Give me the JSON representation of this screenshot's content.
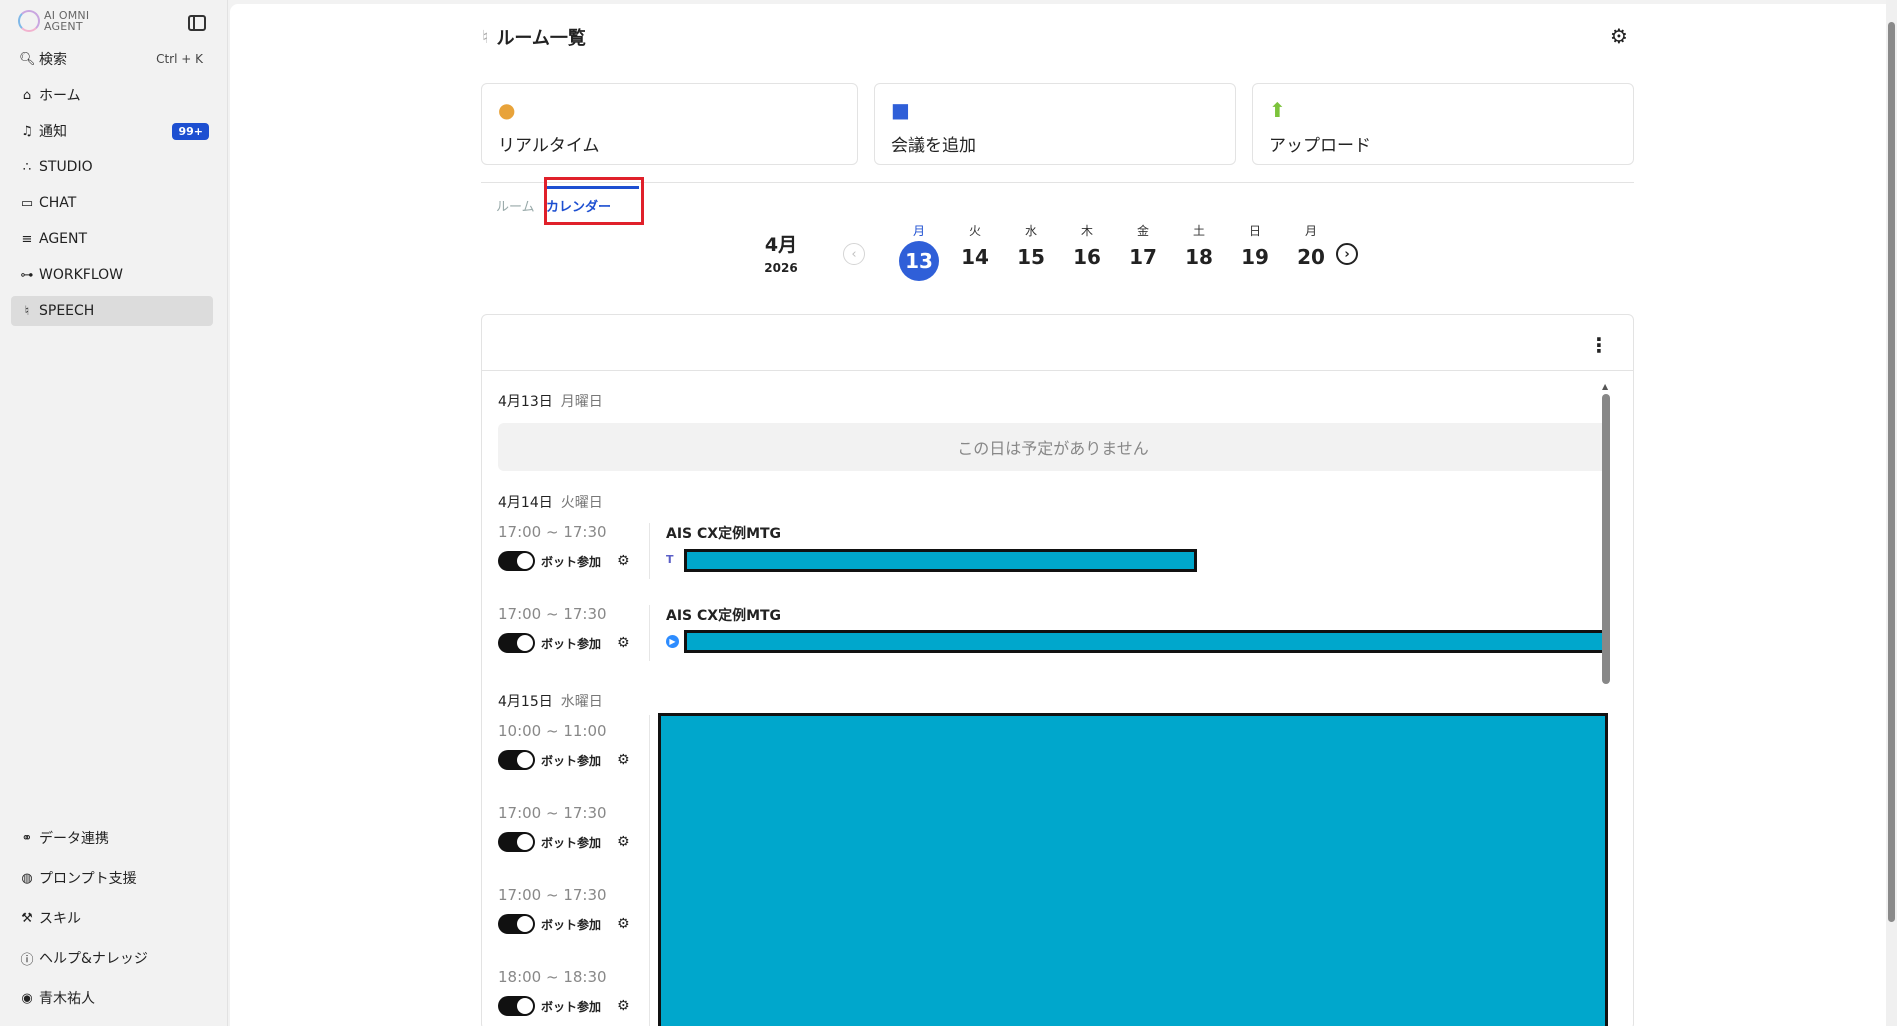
{
  "app": {
    "logo_line1": "AI OMNI",
    "logo_line2": "AGENT"
  },
  "sidebar": {
    "search": {
      "label": "検索",
      "shortcut": "Ctrl + K"
    },
    "items": [
      {
        "label": "ホーム"
      },
      {
        "label": "通知",
        "badge": "99+"
      },
      {
        "label": "STUDIO"
      },
      {
        "label": "CHAT"
      },
      {
        "label": "AGENT"
      },
      {
        "label": "WORKFLOW"
      },
      {
        "label": "SPEECH"
      }
    ],
    "bottom": [
      {
        "label": "データ連携"
      },
      {
        "label": "プロンプト支援"
      },
      {
        "label": "スキル"
      },
      {
        "label": "ヘルプ&ナレッジ"
      },
      {
        "label": "青木祐人"
      }
    ]
  },
  "header": {
    "title": "ルーム一覧"
  },
  "actions": [
    {
      "label": "リアルタイム",
      "color": "#e8a33a"
    },
    {
      "label": "会議を追加",
      "color": "#2f5fd8"
    },
    {
      "label": "アップロード",
      "color": "#7cc33b"
    }
  ],
  "tabs": {
    "room": "ルーム",
    "calendar": "カレンダー"
  },
  "calendar": {
    "month": "4月",
    "year": "2026",
    "days": [
      {
        "dow": "月",
        "num": "13"
      },
      {
        "dow": "火",
        "num": "14"
      },
      {
        "dow": "水",
        "num": "15"
      },
      {
        "dow": "木",
        "num": "16"
      },
      {
        "dow": "金",
        "num": "17"
      },
      {
        "dow": "土",
        "num": "18"
      },
      {
        "dow": "日",
        "num": "19"
      },
      {
        "dow": "月",
        "num": "20"
      }
    ]
  },
  "schedule": {
    "d1": {
      "date": "4月13日",
      "weekday": "月曜日",
      "empty": "この日は予定がありません"
    },
    "d2": {
      "date": "4月14日",
      "weekday": "火曜日"
    },
    "d3": {
      "date": "4月15日",
      "weekday": "水曜日"
    },
    "bot_label": "ボット参加",
    "events": [
      {
        "time": "17:00 ~ 17:30",
        "title": "AIS CX定例MTG"
      },
      {
        "time": "17:00 ~ 17:30",
        "title": "AIS CX定例MTG"
      },
      {
        "time": "10:00 ~ 11:00"
      },
      {
        "time": "17:00 ~ 17:30"
      },
      {
        "time": "17:00 ~ 17:30"
      },
      {
        "time": "18:00 ~ 18:30"
      }
    ]
  }
}
